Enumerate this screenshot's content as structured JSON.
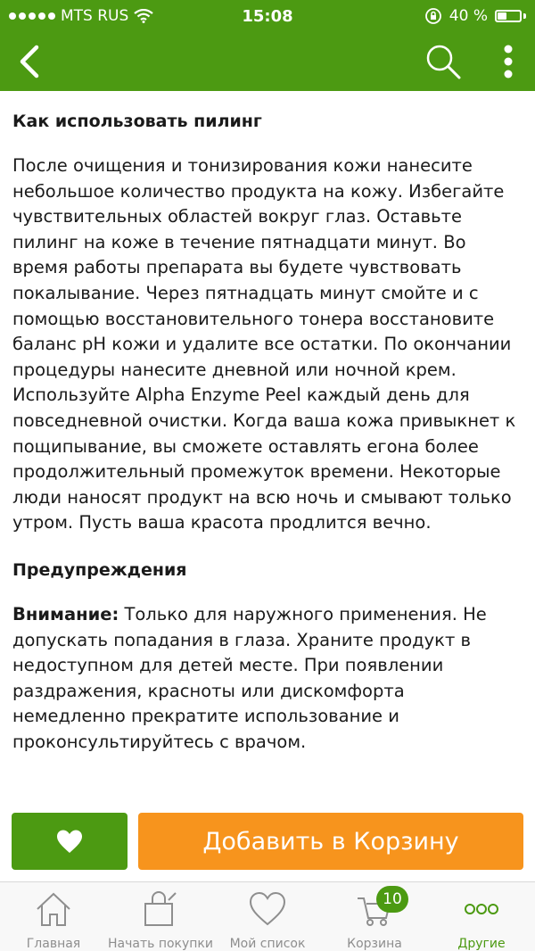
{
  "status_bar": {
    "carrier": "MTS RUS",
    "time": "15:08",
    "battery_text": "40 %",
    "battery_level": 0.4
  },
  "nav": {
    "back_icon": "chevron-left-icon",
    "search_icon": "search-icon",
    "more_icon": "more-vertical-icon"
  },
  "content": {
    "usage_title": "Как использовать пилинг",
    "usage_text": "После очищения и тонизирования кожи нанесите небольшое количество продукта на кожу. Избегайте чувствительных областей вокруг глаз. Оставьте пилинг на коже в течение пятнадцати минут. Во время работы препарата вы будете чувствовать покалывание. Через пятнадцать минут смойте и с помощью восстановительного тонера восстановите баланс pH кожи и удалите все остатки. По окончании процедуры нанесите дневной или ночной крем. Используйте Alpha Enzyme Peel каждый день для повседневной очистки. Когда ваша кожа привыкнет к пощипывание, вы сможете оставлять егона более продолжительный промежуток времени. Некоторые люди наносят продукт на всю ночь и смывают только утром. Пусть ваша красота продлится вечно.",
    "warnings_title": "Предупреждения",
    "warning_label": "Внимание:",
    "warning_text": " Только для наружного применения. Не допускать попадания в глаза. Храните продукт в недоступном для детей месте. При появлении раздражения, красноты или дискомфорта немедленно прекратите использование и проконсультируйтесь с врачом."
  },
  "actions": {
    "wishlist_icon": "heart-icon",
    "add_to_cart_label": "Добавить в Корзину"
  },
  "tabs": [
    {
      "label": "Главная",
      "icon": "home-icon"
    },
    {
      "label": "Начать покупки",
      "icon": "shopping-bag-icon"
    },
    {
      "label": "Мой список",
      "icon": "heart-outline-icon"
    },
    {
      "label": "Корзина",
      "icon": "cart-icon",
      "badge": "10"
    },
    {
      "label": "Другие",
      "icon": "more-dots-icon",
      "active": true
    }
  ],
  "colors": {
    "brand_green": "#4c9a12",
    "cart_orange": "#f7941d",
    "tab_inactive": "#8e8e8e"
  }
}
